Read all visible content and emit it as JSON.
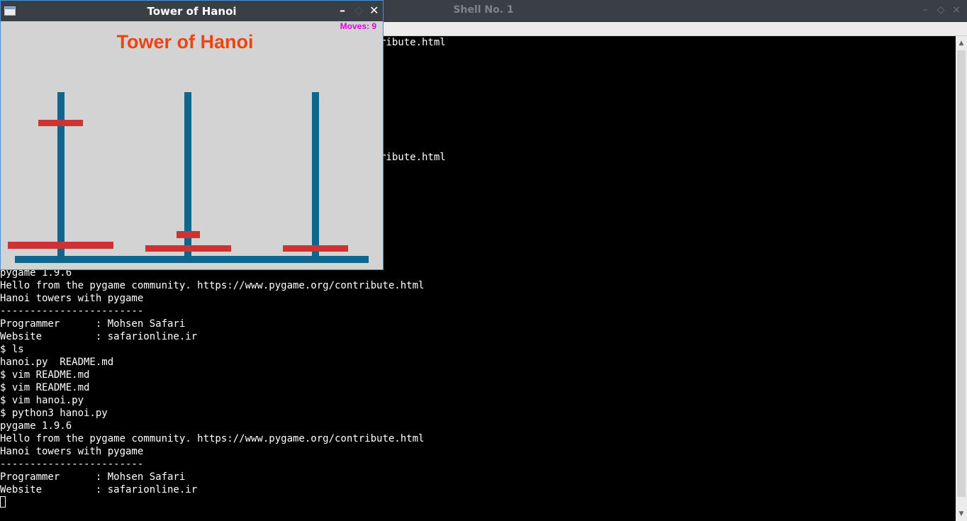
{
  "shell": {
    "title": "Shell No. 1",
    "controls": {
      "minimize": "–",
      "maximize": "◇",
      "close": "×"
    },
    "lines_partial": [
      "ribute.html",
      "ribute.html"
    ],
    "lines": [
      "pygame 1.9.6",
      "Hello from the pygame community. https://www.pygame.org/contribute.html",
      "Hanoi towers with pygame",
      "------------------------",
      "Programmer      : Mohsen Safari",
      "Website         : safarionline.ir",
      "$ ls",
      "hanoi.py  README.md",
      "$ vim README.md",
      "$ vim README.md",
      "$ vim hanoi.py",
      "$ python3 hanoi.py",
      "pygame 1.9.6",
      "Hello from the pygame community. https://www.pygame.org/contribute.html",
      "Hanoi towers with pygame",
      "------------------------",
      "Programmer      : Mohsen Safari",
      "Website         : safarionline.ir"
    ]
  },
  "hanoi": {
    "window_title": "Tower of Hanoi",
    "controls": {
      "minimize": "–",
      "maximize": "◇",
      "close": "✕"
    },
    "moves_label": "Moves: 9",
    "game_title": "Tower of Hanoi",
    "colors": {
      "peg": "#10658a",
      "disk": "#cc3333",
      "background": "#d3d3d3",
      "title": "#ee4411",
      "moves": "#e000e0"
    }
  }
}
